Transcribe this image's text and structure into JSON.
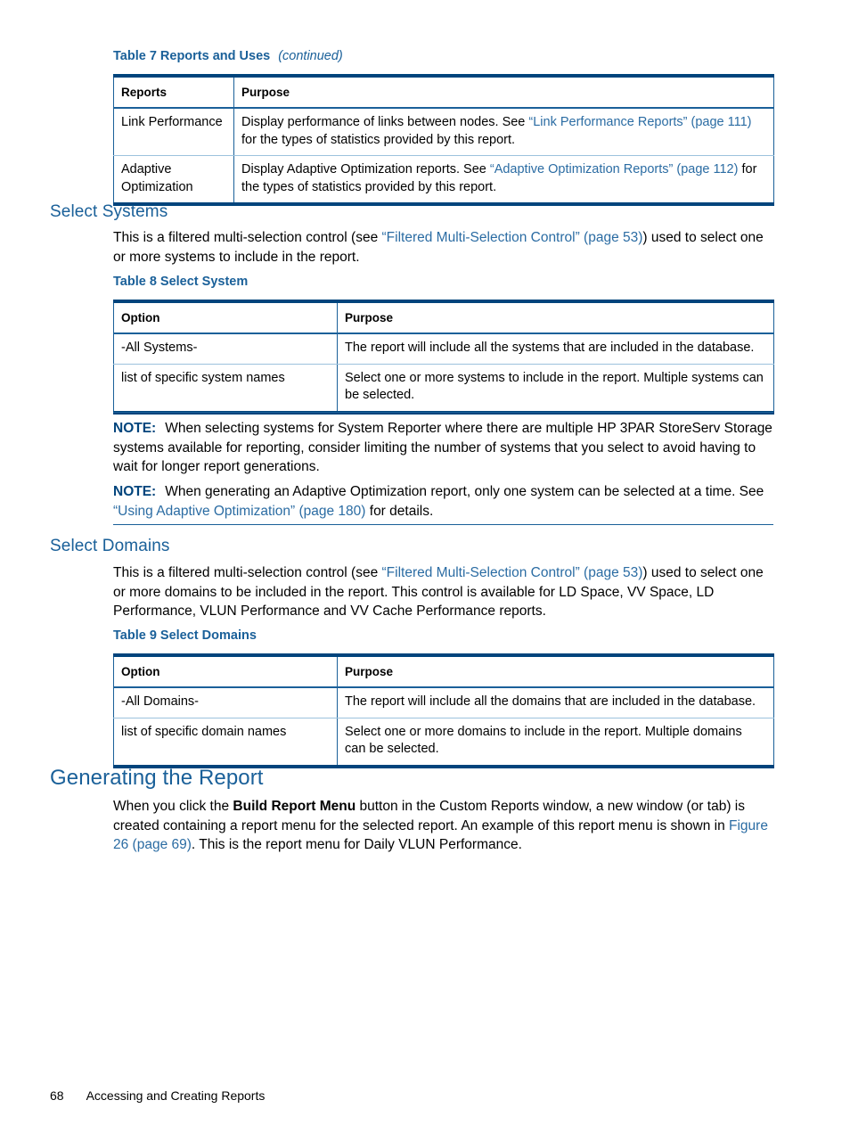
{
  "tables": {
    "table7": {
      "caption_main": "Table 7 Reports and Uses",
      "caption_continued": "(continued)",
      "columns": [
        "Reports",
        "Purpose"
      ],
      "rows": [
        {
          "option": "Link Performance",
          "purpose_pre": "Display performance of links between nodes. See ",
          "purpose_link": "“Link Performance Reports” (page 111)",
          "purpose_post": " for the types of statistics provided by this report."
        },
        {
          "option": "Adaptive Optimization",
          "purpose_pre": "Display Adaptive Optimization reports. See ",
          "purpose_link": "“Adaptive Optimization Reports” (page 112)",
          "purpose_post": " for the types of statistics provided by this report."
        }
      ]
    },
    "table8": {
      "caption_main": "Table 8 Select System",
      "columns": [
        "Option",
        "Purpose"
      ],
      "rows": [
        {
          "option": "-All Systems-",
          "purpose": "The report will include all the systems that are included in the database."
        },
        {
          "option": "list of specific system names",
          "purpose": "Select one or more systems to include in the report. Multiple systems can be selected."
        }
      ]
    },
    "table9": {
      "caption_main": "Table 9 Select Domains",
      "columns": [
        "Option",
        "Purpose"
      ],
      "rows": [
        {
          "option": "-All Domains-",
          "purpose": "The report will include all the domains that are included in the database."
        },
        {
          "option": "list of specific domain names",
          "purpose": "Select one or more domains to include in the report. Multiple domains can be selected."
        }
      ]
    }
  },
  "sections": {
    "select_systems": {
      "heading": "Select Systems",
      "para_pre": "This is a filtered multi-selection control (see ",
      "para_link": "“Filtered Multi-Selection Control” (page 53)",
      "para_post": ") used to select one or more systems to include in the report."
    },
    "select_domains": {
      "heading": "Select Domains",
      "para_pre": "This is a filtered multi-selection control (see ",
      "para_link": "“Filtered Multi-Selection Control” (page 53)",
      "para_post": ") used to select one or more domains to be included in the report. This control is available for LD Space, VV Space, LD Performance, VLUN Performance and VV Cache Performance reports."
    },
    "generating_the_report": {
      "heading": "Generating the Report",
      "para_pre": "When you click the ",
      "para_bold": "Build Report Menu",
      "para_mid": " button in the Custom Reports window, a new window (or tab) is created containing a report menu for the selected report. An example of this report menu is shown in ",
      "para_link": "Figure 26 (page 69)",
      "para_post": ". This is the report menu for Daily VLUN Performance."
    }
  },
  "notes": {
    "label": "NOTE:",
    "note1_text": "When selecting systems for System Reporter where there are multiple HP 3PAR StoreServ Storage systems available for reporting, consider limiting the number of systems that you select to avoid having to wait for longer report generations.",
    "note2_pre": "When generating an Adaptive Optimization report, only one system can be selected at a time. See ",
    "note2_link": "“Using Adaptive Optimization” (page 180)",
    "note2_post": " for details."
  },
  "footer": {
    "page_number": "68",
    "chapter_title": "Accessing and Creating Reports"
  },
  "colors": {
    "heading_blue": "#1a6099",
    "link_blue": "#2b6ca3",
    "table_border_dark": "#00447c",
    "table_border_light": "#9cc2dd"
  }
}
